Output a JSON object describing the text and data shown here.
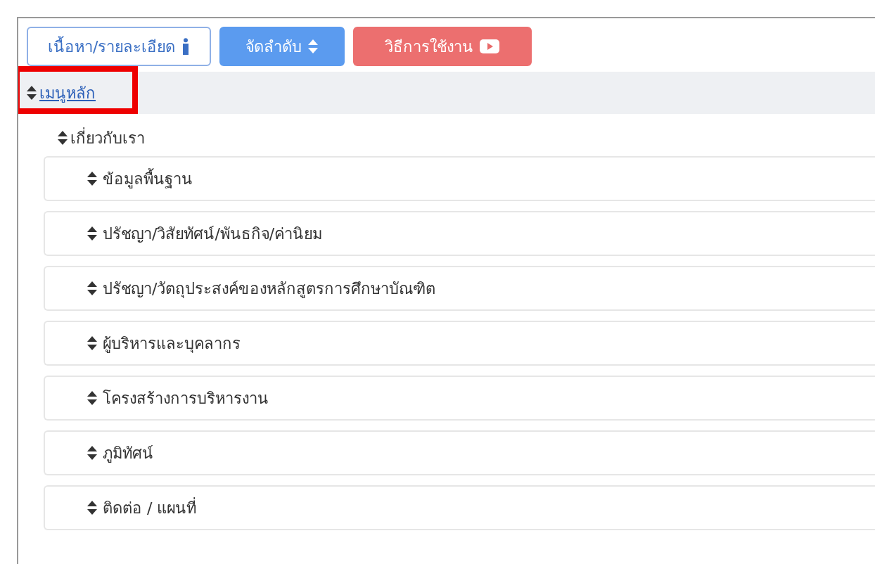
{
  "toolbar": {
    "buttons": [
      {
        "label": "เนื้อหา/รายละเอียด",
        "kind": "outline"
      },
      {
        "label": "จัดลำดับ",
        "kind": "primary"
      },
      {
        "label": "วิธีการใช้งาน",
        "kind": "danger"
      }
    ]
  },
  "menu": {
    "title": "เมนูหลัก",
    "highlighted": true,
    "items": [
      {
        "label": "เกี่ยวกับเรา",
        "children": [
          {
            "label": "ข้อมูลพื้นฐาน"
          },
          {
            "label": "ปรัชญา/วิสัยทัศน์/พันธกิจ/ค่านิยม"
          },
          {
            "label": "ปรัชญา/วัตถุประสงค์ของหลักสูตรการศึกษาบัณฑิต"
          },
          {
            "label": "ผู้บริหารและบุคลากร"
          },
          {
            "label": "โครงสร้างการบริหารงาน"
          },
          {
            "label": "ภูมิทัศน์"
          },
          {
            "label": "ติดต่อ / แผนที่"
          }
        ]
      }
    ]
  }
}
